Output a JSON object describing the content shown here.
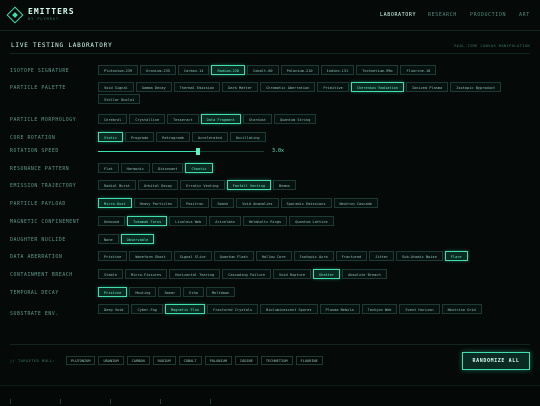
{
  "header": {
    "brand": "EMITTERS",
    "brand_sub": "BY PLYMRKT",
    "nav": [
      {
        "label": "LABORATORY",
        "active": true
      },
      {
        "label": "RESEARCH",
        "active": false
      },
      {
        "label": "PRODUCTION",
        "active": false
      },
      {
        "label": "ART",
        "active": false
      }
    ]
  },
  "page": {
    "title": "LIVE TESTING LABORATORY",
    "subtitle": "REAL-TIME CANVAS MANIPULATION"
  },
  "rows": [
    {
      "label": "ISOTOPE SIGNATURE",
      "options": [
        "Plutonium-239",
        "Uranium-235",
        "Carbon-14",
        "Radium-226",
        "Cobalt-60",
        "Polonium-210",
        "Iodine-131",
        "Technetium-99m",
        "Fluorine-18"
      ],
      "active": [
        "Radium-226"
      ]
    },
    {
      "label": "PARTICLE PALETTE",
      "options": [
        "Void Signal",
        "Gamma Decay",
        "Thermal Emission",
        "Dark Matter",
        "Chromatic Aberration",
        "Primitive",
        "Cherenkov Radiation",
        "Ionized Plasma",
        "Isotopic Byproduct",
        "Stellar Nuclei"
      ],
      "active": [
        "Cherenkov Radiation"
      ]
    },
    {
      "label": "PARTICLE MORPHOLOGY",
      "options": [
        "Cerebral",
        "Crystalline",
        "Tesseract",
        "Data Fragment",
        "Stardust",
        "Quantum String"
      ],
      "active": [
        "Data Fragment"
      ]
    },
    {
      "label": "CORE ROTATION",
      "options": [
        "Static",
        "Prograde",
        "Retrograde",
        "Accelerated",
        "Oscillating"
      ],
      "active": [
        "Static"
      ]
    },
    {
      "label": "RESONANCE PATTERN",
      "options": [
        "Flat",
        "Harmonic",
        "Dissonant",
        "Chaotic"
      ],
      "active": [
        "Chaotic"
      ]
    },
    {
      "label": "EMISSION TRAJECTORY",
      "options": [
        "Radial Burst",
        "Orbital Decay",
        "Erratic Venting",
        "Fanfall Venting",
        "Beams"
      ],
      "active": [
        "Fanfall Venting"
      ]
    },
    {
      "label": "PARTICLE PAYLOAD",
      "options": [
        "Micro-Dust",
        "Heavy Particles",
        "Positron",
        "Smash",
        "Void Anomalies",
        "Sporadic Emissions",
        "Neutron Cascade"
      ],
      "active": [
        "Micro-Dust"
      ]
    },
    {
      "label": "MAGNETIC CONFINEMENT",
      "options": [
        "Unbound",
        "Tokamak Torus",
        "Linoleus Web",
        "Ariveldan",
        "Helmholtz Rings",
        "Quantum Lattice"
      ],
      "active": [
        "Tokamak Torus"
      ]
    },
    {
      "label": "DAUGHTER NUCLIDE",
      "options": [
        "None",
        "Observable"
      ],
      "active": [
        "Observable"
      ]
    },
    {
      "label": "DATA ABERRATION",
      "options": [
        "Pristine",
        "Waveform Ghost",
        "Signal Slice",
        "Quantum Flash",
        "Hollow Core",
        "Isotopic Aura",
        "Fractured",
        "Jitter",
        "Sub-Atomic Noise",
        "Flare"
      ],
      "active": [
        "Flare"
      ]
    },
    {
      "label": "CONTAINMENT BREACH",
      "options": [
        "Stable",
        "Micro-Fissures",
        "Horizontal Tearing",
        "Cascading Failure",
        "Void Rupture",
        "Shatter",
        "Absolute Breach"
      ],
      "active": [
        "Shatter"
      ]
    },
    {
      "label": "TEMPORAL DECAY",
      "options": [
        "Pristine",
        "Mouting",
        "Smear",
        "Echo",
        "Meltdown"
      ],
      "active": [
        "Pristine"
      ]
    },
    {
      "label": "SUBSTRATE ENV.",
      "options": [
        "Deep Void",
        "Cyber-Fog",
        "Magnetic Flux",
        "Fractured Crystals",
        "Bioluminescent Spores",
        "Plasma Nebula",
        "Tachyon Web",
        "Event Horizon",
        "Neutrino Grid"
      ],
      "active": [
        "Magnetic Flux"
      ]
    }
  ],
  "rotation_speed": {
    "label": "ROTATION SPEED",
    "value": 0.6,
    "display": "3.0x"
  },
  "footer": {
    "targeted_label": "// TARGETED MOLL:",
    "chips": [
      "PLUTONIUM",
      "URANIUM",
      "CARBON",
      "RADIUM",
      "COBALT",
      "POLONIUM",
      "IODINE",
      "TECHNETIUM",
      "FLUORINE"
    ],
    "randomize_label": "RANDOMIZE ALL"
  },
  "colors": {
    "accent": "#3fe0b0",
    "background": "#050a09"
  }
}
